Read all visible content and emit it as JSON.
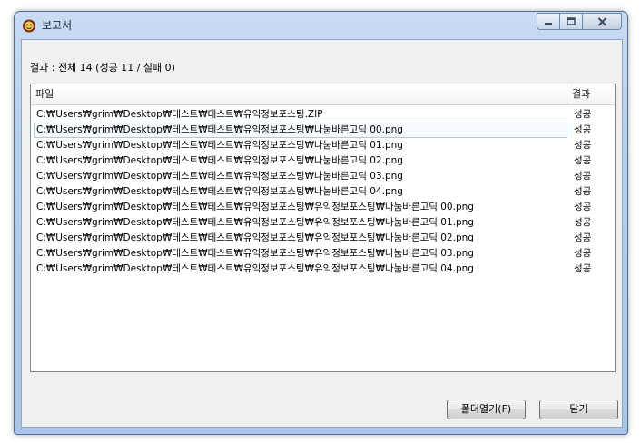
{
  "window": {
    "title": "보고서"
  },
  "summary": "결과 : 전체 14 (성공 11 / 실패 0)",
  "list": {
    "headers": {
      "file": "파일",
      "result": "결과"
    },
    "rows": [
      {
        "file": "C:₩Users₩grim₩Desktop₩테스트₩테스트₩유익정보포스팅.ZIP",
        "result": "성공"
      },
      {
        "file": "C:₩Users₩grim₩Desktop₩테스트₩테스트₩유익정보포스팅₩나눔바른고딕 00.png",
        "result": "성공"
      },
      {
        "file": "C:₩Users₩grim₩Desktop₩테스트₩테스트₩유익정보포스팅₩나눔바른고딕 01.png",
        "result": "성공"
      },
      {
        "file": "C:₩Users₩grim₩Desktop₩테스트₩테스트₩유익정보포스팅₩나눔바른고딕 02.png",
        "result": "성공"
      },
      {
        "file": "C:₩Users₩grim₩Desktop₩테스트₩테스트₩유익정보포스팅₩나눔바른고딕 03.png",
        "result": "성공"
      },
      {
        "file": "C:₩Users₩grim₩Desktop₩테스트₩테스트₩유익정보포스팅₩나눔바른고딕 04.png",
        "result": "성공"
      },
      {
        "file": "C:₩Users₩grim₩Desktop₩테스트₩테스트₩유익정보포스팅₩유익정보포스팅₩나눔바른고딕 00.png",
        "result": "성공"
      },
      {
        "file": "C:₩Users₩grim₩Desktop₩테스트₩테스트₩유익정보포스팅₩유익정보포스팅₩나눔바른고딕 01.png",
        "result": "성공"
      },
      {
        "file": "C:₩Users₩grim₩Desktop₩테스트₩테스트₩유익정보포스팅₩유익정보포스팅₩나눔바른고딕 02.png",
        "result": "성공"
      },
      {
        "file": "C:₩Users₩grim₩Desktop₩테스트₩테스트₩유익정보포스팅₩유익정보포스팅₩나눔바른고딕 03.png",
        "result": "성공"
      },
      {
        "file": "C:₩Users₩grim₩Desktop₩테스트₩테스트₩유익정보포스팅₩유익정보포스팅₩나눔바른고딕 04.png",
        "result": "성공"
      }
    ]
  },
  "buttons": {
    "open_folder": "폴더열기(F)",
    "close": "닫기"
  },
  "icons": {
    "app": "app-icon",
    "minimize": "minimize-icon",
    "maximize": "maximize-icon",
    "close": "close-icon"
  }
}
